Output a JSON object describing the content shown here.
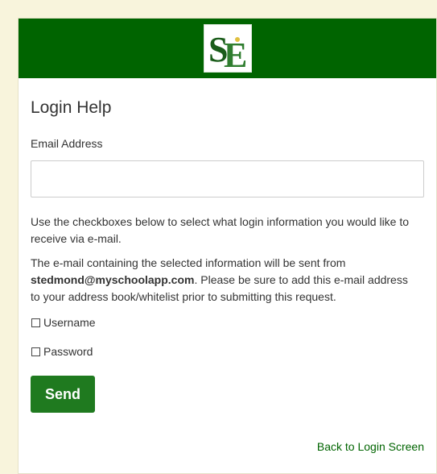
{
  "theme": {
    "header_color": "#006400",
    "button_color": "#1f7a1f",
    "page_background": "#f8f4dc",
    "link_color": "#006400"
  },
  "header": {
    "logo_icon": "school-logo-icon"
  },
  "page": {
    "title": "Login Help"
  },
  "email": {
    "label": "Email Address",
    "value": "",
    "placeholder": ""
  },
  "instructions": {
    "paragraph1": "Use the checkboxes below to select what login information you would like to receive via e-mail.",
    "paragraph2_prefix": "The e-mail containing the selected information will be sent from ",
    "paragraph2_email": "stedmond@myschoolapp.com",
    "paragraph2_suffix": ". Please be sure to add this e-mail address to your address book/whitelist prior to submitting this request."
  },
  "options": [
    {
      "label": "Username",
      "checked": false
    },
    {
      "label": "Password",
      "checked": false
    }
  ],
  "actions": {
    "send_label": "Send",
    "back_label": "Back to Login Screen"
  }
}
